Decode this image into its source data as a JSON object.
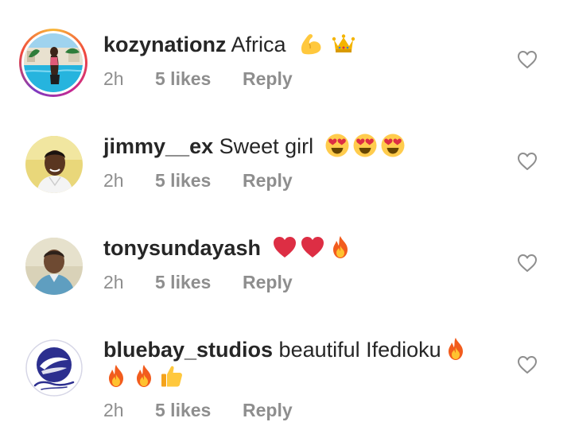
{
  "colors": {
    "text": "#262626",
    "meta": "#8e8e8e",
    "heart_outline": "#8e8e8e"
  },
  "comments": [
    {
      "username": "kozynationz",
      "text": " Africa",
      "emojis": [
        "flexed-biceps",
        "crown"
      ],
      "time": "2h",
      "likes": "5 likes",
      "reply": "Reply",
      "story_ring": true
    },
    {
      "username": "jimmy__ex",
      "text": " Sweet girl",
      "emojis": [
        "heart-eyes",
        "heart-eyes",
        "heart-eyes"
      ],
      "time": "2h",
      "likes": "5 likes",
      "reply": "Reply"
    },
    {
      "username": "tonysundayash",
      "text": "",
      "emojis": [
        "red-heart",
        "red-heart",
        "fire"
      ],
      "time": "2h",
      "likes": "5 likes",
      "reply": "Reply"
    },
    {
      "username": "bluebay_studios",
      "text": " beautiful Ifedioku",
      "emojis": [
        "fire"
      ],
      "emojis_line2": [
        "fire",
        "fire",
        "thumbs-up"
      ],
      "time": "2h",
      "likes": "5 likes",
      "reply": "Reply"
    }
  ]
}
